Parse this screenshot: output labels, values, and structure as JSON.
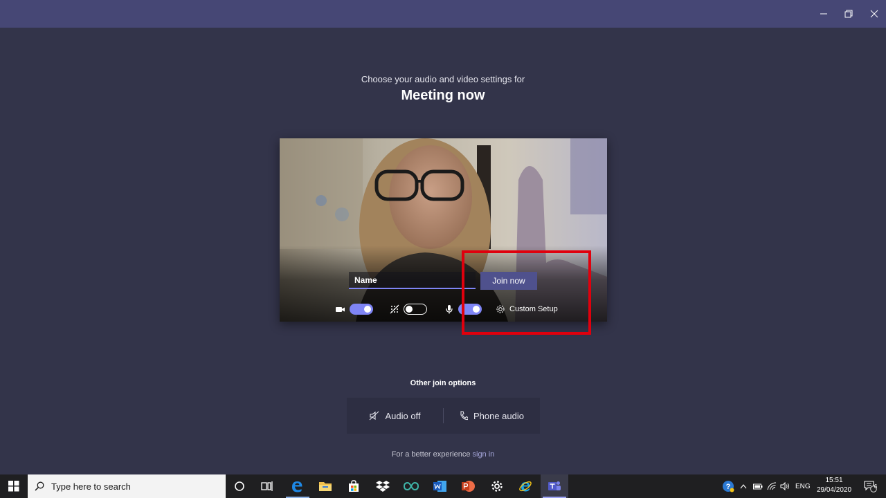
{
  "colors": {
    "titlebar": "#464775",
    "background": "#33344a",
    "accent": "#7f85f5",
    "join_button": "#4f518d",
    "highlight": "#e0000d"
  },
  "window": {
    "controls": [
      "minimize-icon",
      "restore-icon",
      "close-icon"
    ]
  },
  "prejoin": {
    "subtitle": "Choose your audio and video settings for",
    "title": "Meeting now",
    "name_placeholder": "Name",
    "join_label": "Join now",
    "camera_on": true,
    "blur_on": false,
    "mic_on": true,
    "custom_setup_label": "Custom Setup"
  },
  "other_options": {
    "title": "Other join options",
    "audio_off_label": "Audio off",
    "phone_audio_label": "Phone audio"
  },
  "signin": {
    "prefix": "For a better experience",
    "link": "sign in"
  },
  "taskbar": {
    "search_placeholder": "Type here to search",
    "apps": [
      "cortana-icon",
      "task-view-icon",
      "edge-icon",
      "file-explorer-icon",
      "store-icon",
      "dropbox-icon",
      "arduino-icon",
      "word-icon",
      "powerpoint-icon",
      "settings-icon",
      "internet-explorer-icon",
      "teams-icon"
    ],
    "active_app": "teams-icon",
    "language": "ENG",
    "time": "15:51",
    "date": "29/04/2020",
    "notification_count": "6"
  }
}
